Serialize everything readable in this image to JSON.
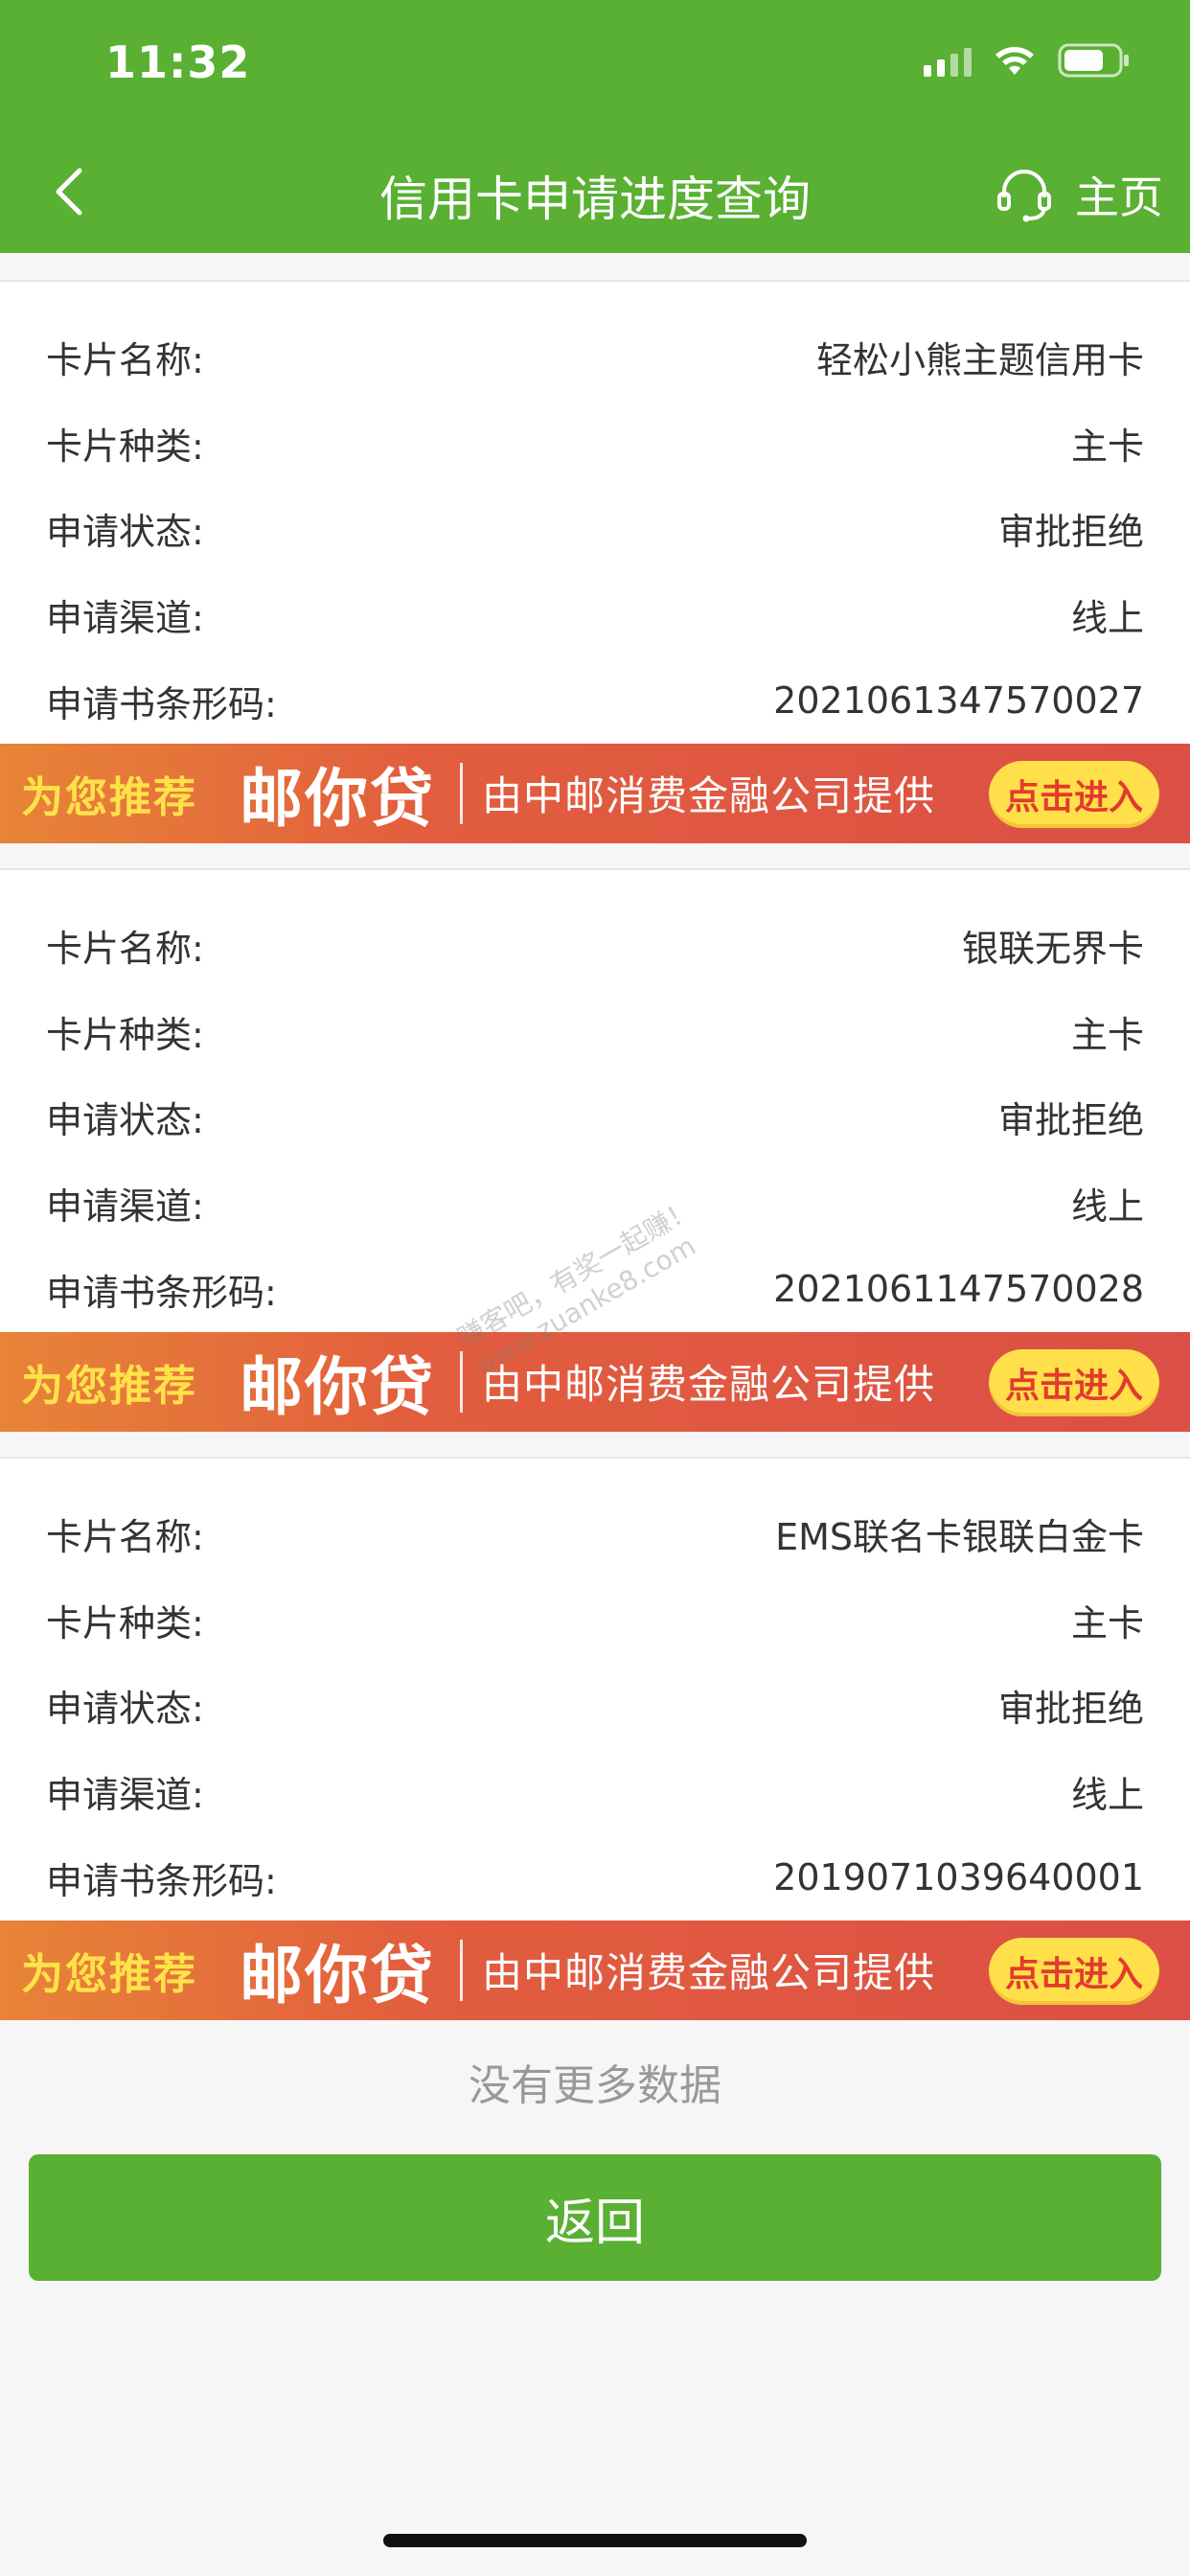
{
  "status_bar": {
    "time": "11:32",
    "icons": [
      "signal-icon",
      "wifi-icon",
      "battery-icon"
    ]
  },
  "nav": {
    "back_icon": "chevron-left-icon",
    "title": "信用卡申请进度查询",
    "home_icon": "headset-icon",
    "home_label": "主页"
  },
  "records": [
    {
      "rows": [
        {
          "label": "卡片名称:",
          "value": "轻松小熊主题信用卡"
        },
        {
          "label": "卡片种类:",
          "value": "主卡"
        },
        {
          "label": "申请状态:",
          "value": "审批拒绝"
        },
        {
          "label": "申请渠道:",
          "value": "线上"
        },
        {
          "label": "申请书条形码:",
          "value": "2021061347570027"
        }
      ],
      "promo": {
        "recommend": "为您推荐",
        "product": "邮你贷",
        "provider": "由中邮消费金融公司提供",
        "button": "点击进入"
      }
    },
    {
      "rows": [
        {
          "label": "卡片名称:",
          "value": "银联无界卡"
        },
        {
          "label": "卡片种类:",
          "value": "主卡"
        },
        {
          "label": "申请状态:",
          "value": "审批拒绝"
        },
        {
          "label": "申请渠道:",
          "value": "线上"
        },
        {
          "label": "申请书条形码:",
          "value": "2021061147570028"
        }
      ],
      "promo": {
        "recommend": "为您推荐",
        "product": "邮你贷",
        "provider": "由中邮消费金融公司提供",
        "button": "点击进入"
      }
    },
    {
      "rows": [
        {
          "label": "卡片名称:",
          "value": "EMS联名卡银联白金卡"
        },
        {
          "label": "卡片种类:",
          "value": "主卡"
        },
        {
          "label": "申请状态:",
          "value": "审批拒绝"
        },
        {
          "label": "申请渠道:",
          "value": "线上"
        },
        {
          "label": "申请书条形码:",
          "value": "2019071039640001"
        }
      ],
      "promo": {
        "recommend": "为您推荐",
        "product": "邮你贷",
        "provider": "由中邮消费金融公司提供",
        "button": "点击进入"
      }
    }
  ],
  "footer": {
    "no_more": "没有更多数据",
    "return_label": "返回"
  },
  "watermark": {
    "line1": "赚客吧，有奖一起赚！",
    "line2": "www.zuanke8.com"
  },
  "colors": {
    "primary_green": "#59b033",
    "promo_yellow": "#ffe24a",
    "promo_red": "#dc4f45"
  }
}
